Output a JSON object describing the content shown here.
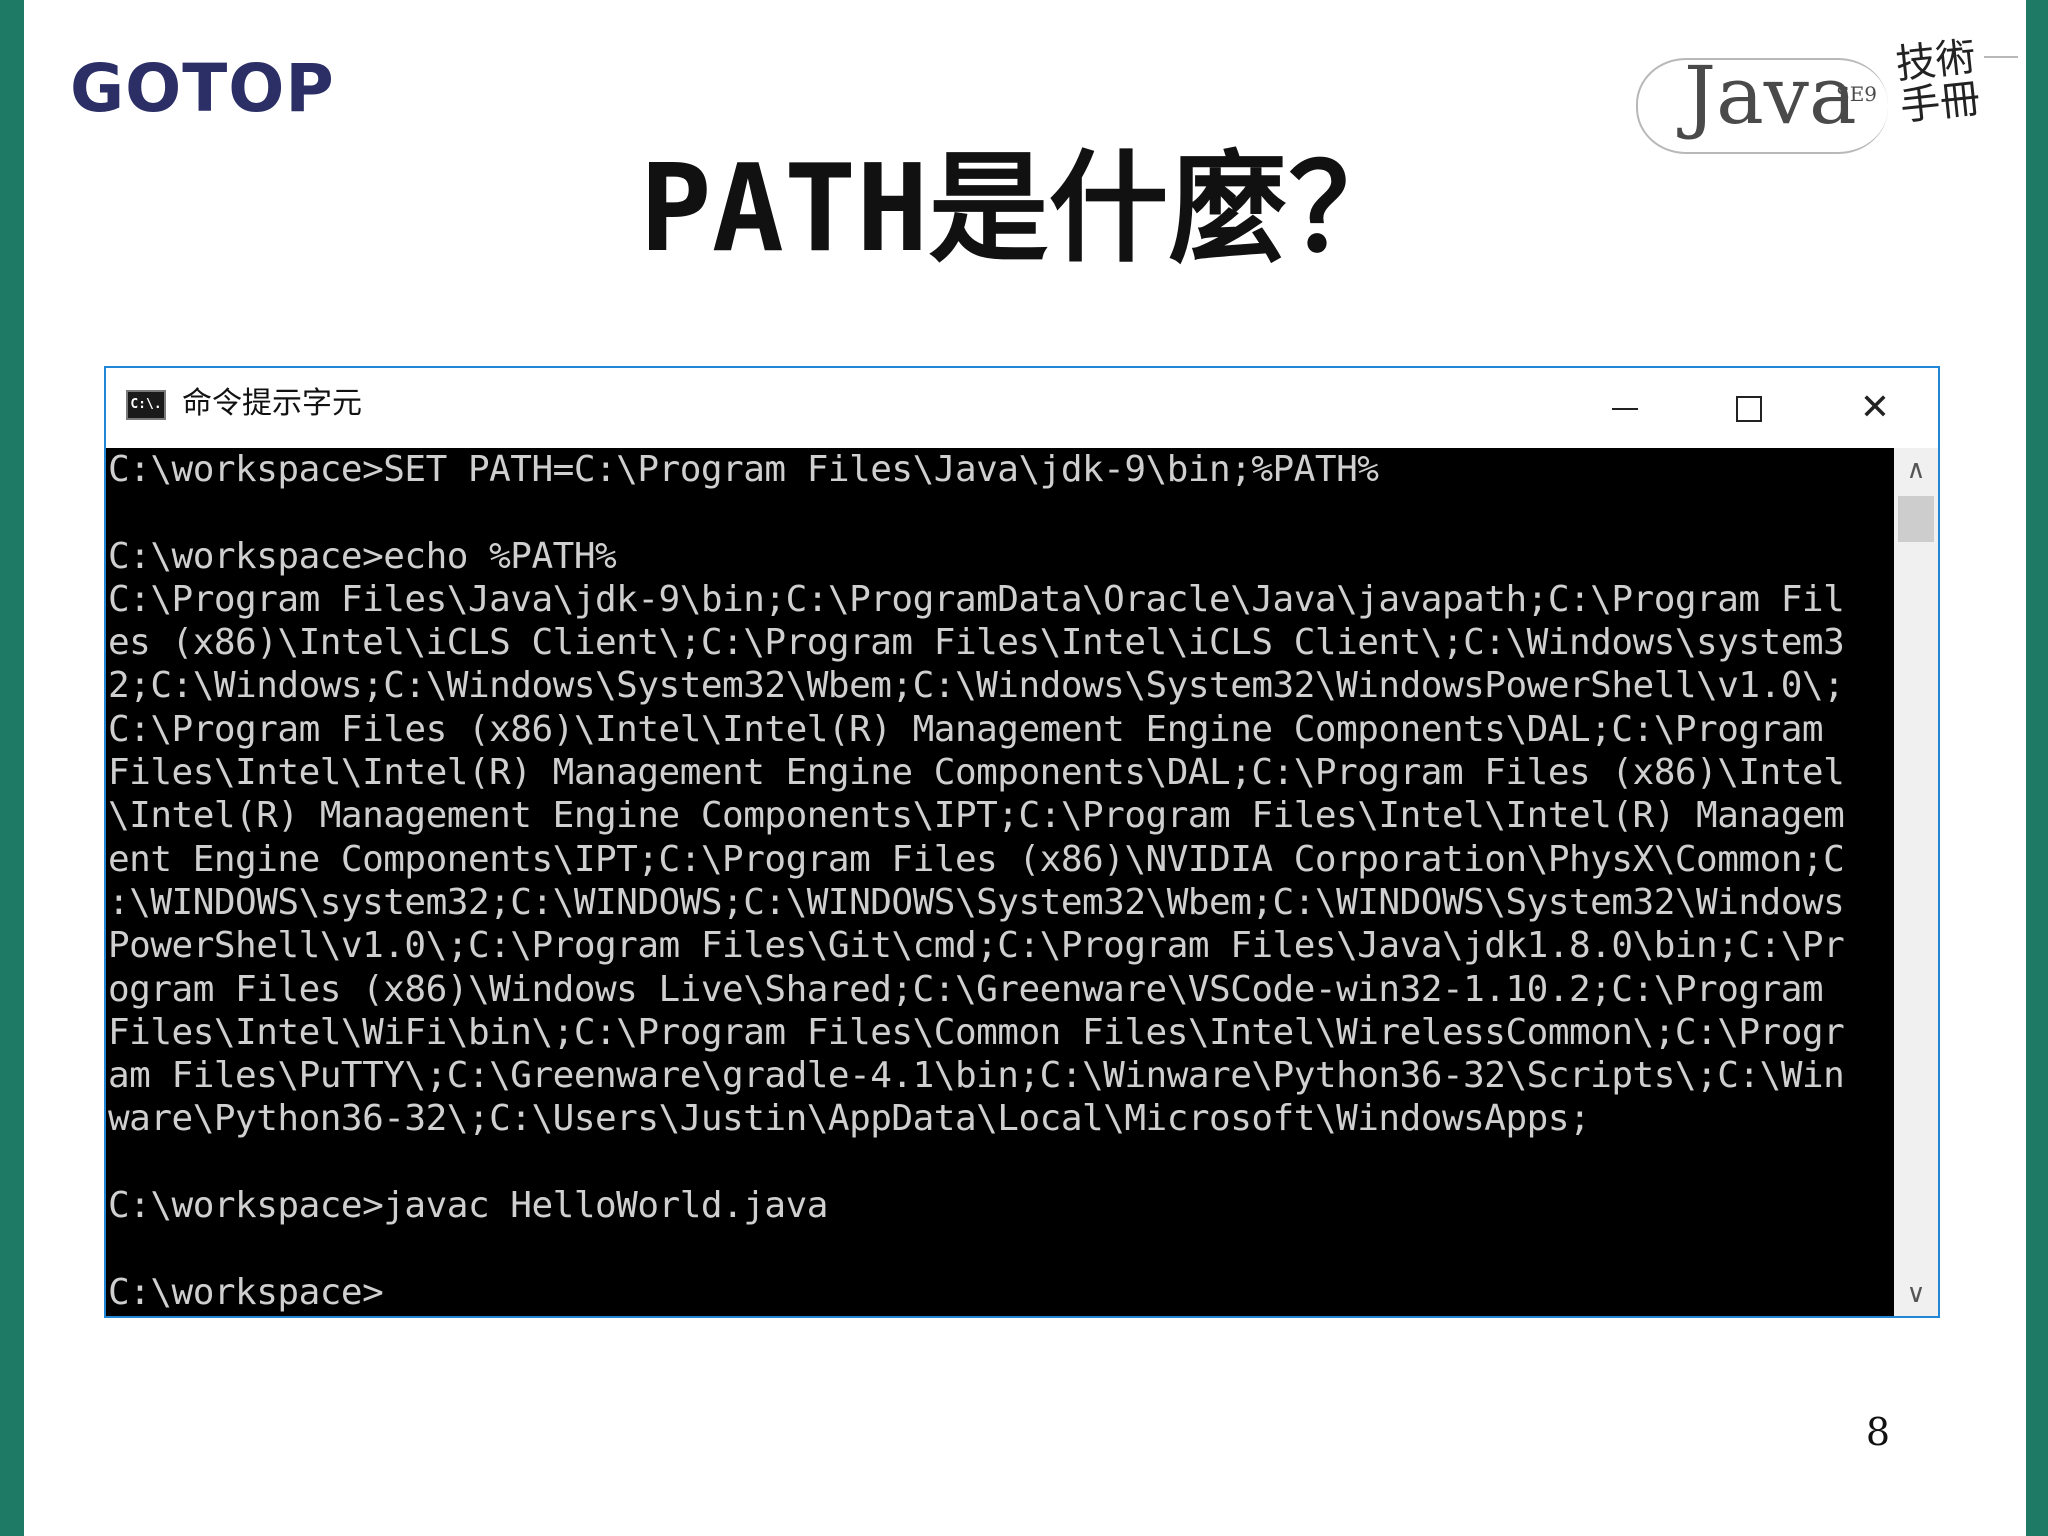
{
  "slide": {
    "logo": "GOTOP",
    "title_latin": "PATH",
    "title_cjk": "是什麼？",
    "page_number": "8",
    "accent_color": "#1e7a64"
  },
  "java_badge": {
    "word": "Java",
    "edition": "SE9",
    "brand": "技術手冊"
  },
  "window": {
    "title": "命令提示字元",
    "app_icon": "C:\\.",
    "minimize_icon": "minimize-icon",
    "maximize_icon": "maximize-icon",
    "close_icon": "close-icon",
    "close_glyph": "✕",
    "scroll_up_glyph": "∧",
    "scroll_down_glyph": "∨",
    "console_lines": [
      "C:\\workspace>SET PATH=C:\\Program Files\\Java\\jdk-9\\bin;%PATH%",
      "",
      "C:\\workspace>echo %PATH%",
      "C:\\Program Files\\Java\\jdk-9\\bin;C:\\ProgramData\\Oracle\\Java\\javapath;C:\\Program Fil",
      "es (x86)\\Intel\\iCLS Client\\;C:\\Program Files\\Intel\\iCLS Client\\;C:\\Windows\\system3",
      "2;C:\\Windows;C:\\Windows\\System32\\Wbem;C:\\Windows\\System32\\WindowsPowerShell\\v1.0\\;",
      "C:\\Program Files (x86)\\Intel\\Intel(R) Management Engine Components\\DAL;C:\\Program",
      "Files\\Intel\\Intel(R) Management Engine Components\\DAL;C:\\Program Files (x86)\\Intel",
      "\\Intel(R) Management Engine Components\\IPT;C:\\Program Files\\Intel\\Intel(R) Managem",
      "ent Engine Components\\IPT;C:\\Program Files (x86)\\NVIDIA Corporation\\PhysX\\Common;C",
      ":\\WINDOWS\\system32;C:\\WINDOWS;C:\\WINDOWS\\System32\\Wbem;C:\\WINDOWS\\System32\\Windows",
      "PowerShell\\v1.0\\;C:\\Program Files\\Git\\cmd;C:\\Program Files\\Java\\jdk1.8.0\\bin;C:\\Pr",
      "ogram Files (x86)\\Windows Live\\Shared;C:\\Greenware\\VSCode-win32-1.10.2;C:\\Program",
      "Files\\Intel\\WiFi\\bin\\;C:\\Program Files\\Common Files\\Intel\\WirelessCommon\\;C:\\Progr",
      "am Files\\PuTTY\\;C:\\Greenware\\gradle-4.1\\bin;C:\\Winware\\Python36-32\\Scripts\\;C:\\Win",
      "ware\\Python36-32\\;C:\\Users\\Justin\\AppData\\Local\\Microsoft\\WindowsApps;",
      "",
      "C:\\workspace>javac HelloWorld.java",
      "",
      "C:\\workspace>"
    ]
  }
}
